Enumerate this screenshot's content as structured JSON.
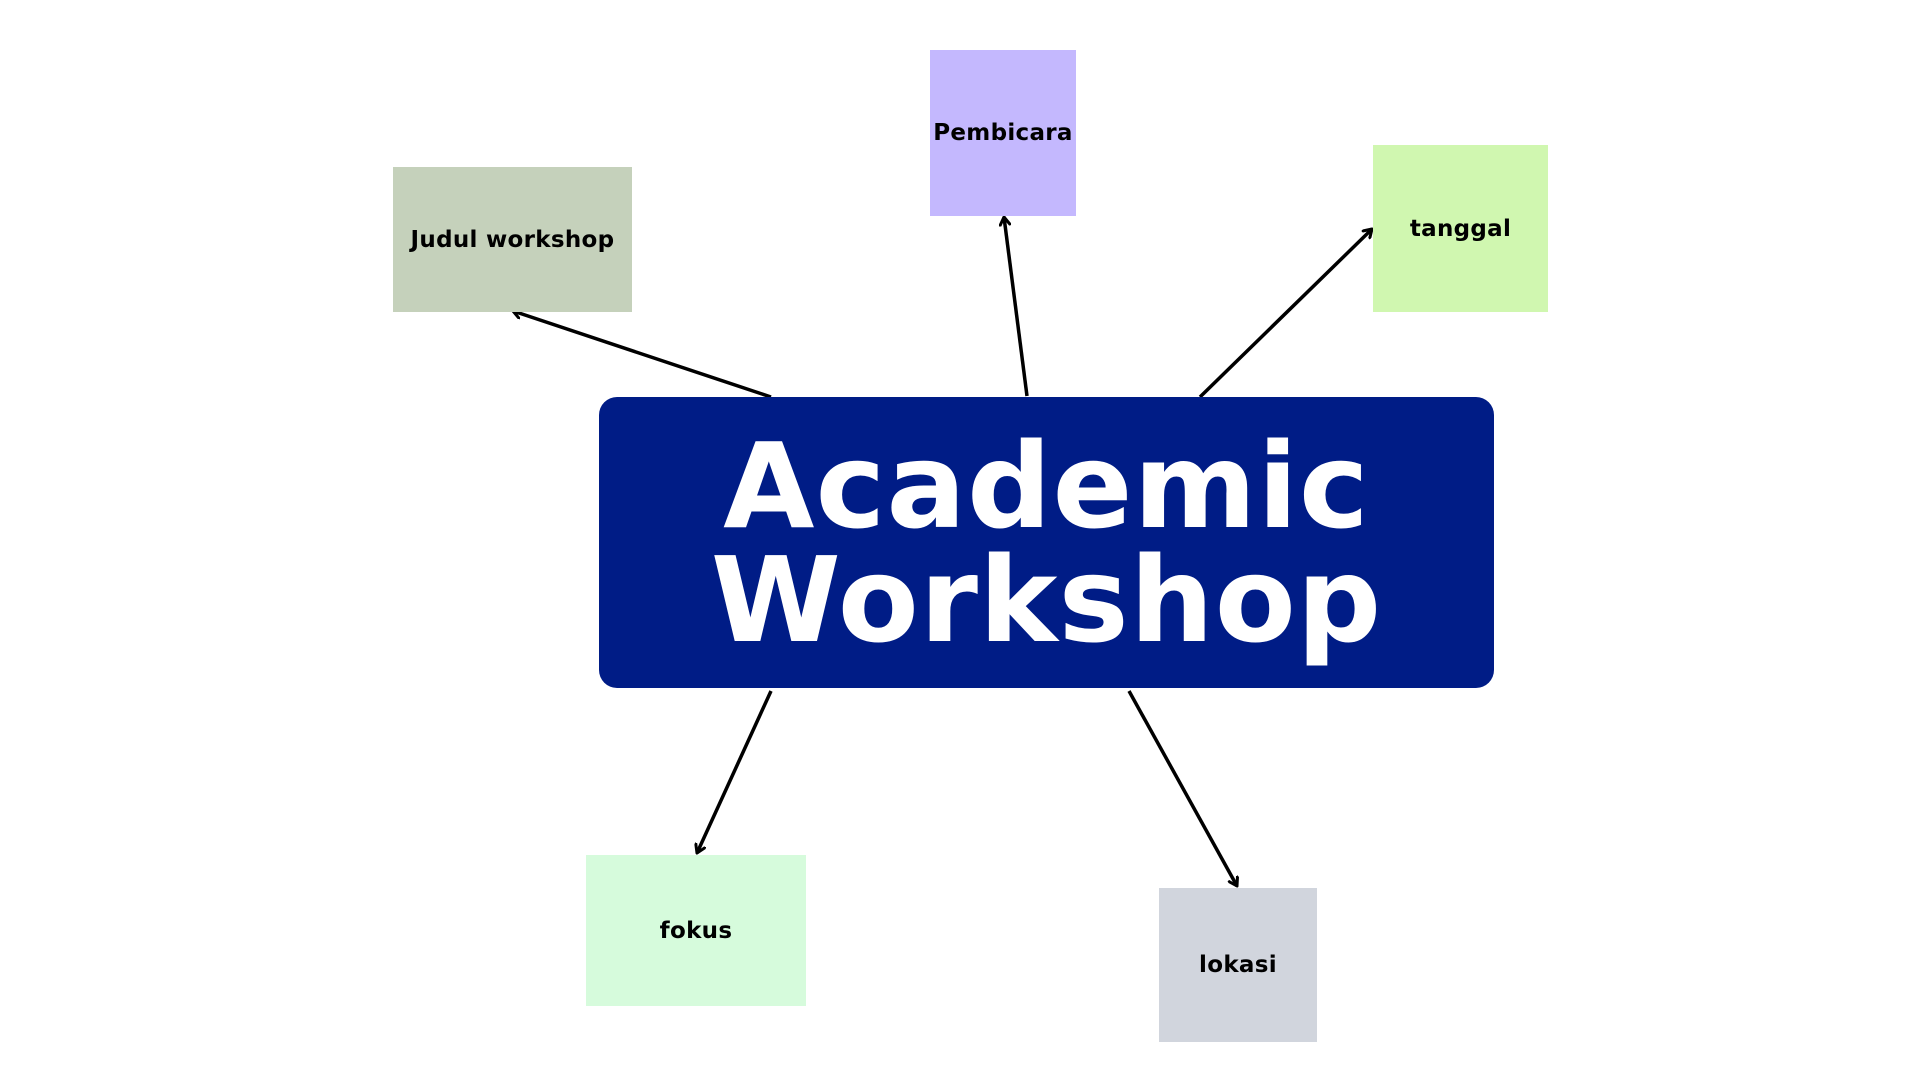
{
  "center": {
    "line1": "Academic",
    "line2": "Workshop",
    "color": "#001c86"
  },
  "nodes": {
    "judul": {
      "label": "Judul workshop",
      "color": "#c5d1bb"
    },
    "pembicara": {
      "label": "Pembicara",
      "color": "#c4b8fe"
    },
    "tanggal": {
      "label": "tanggal",
      "color": "#d0f7b0"
    },
    "fokus": {
      "label": "fokus",
      "color": "#d6fbdc"
    },
    "lokasi": {
      "label": "lokasi",
      "color": "#d1d5dd"
    }
  },
  "arrow_color": "#000000"
}
